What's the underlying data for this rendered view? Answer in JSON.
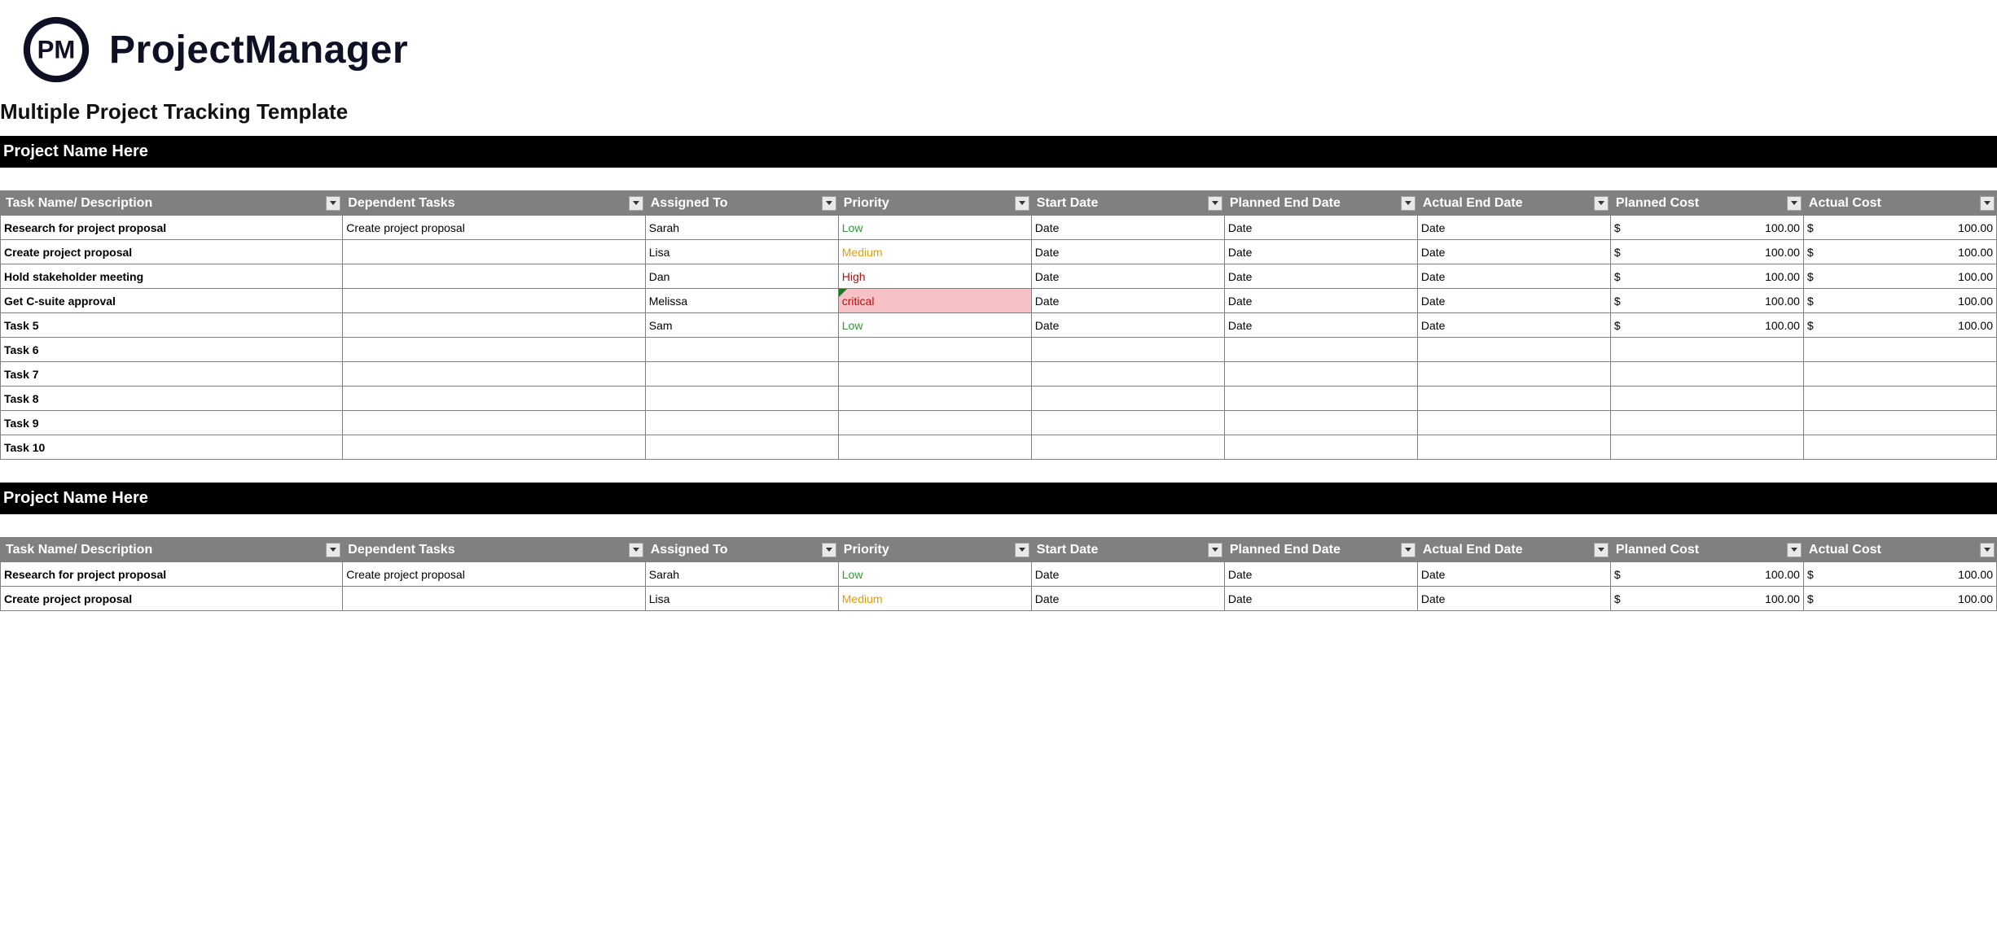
{
  "brand": {
    "logo_text": "PM",
    "title": "ProjectManager"
  },
  "template_title": "Multiple Project Tracking Template",
  "columns": {
    "task": "Task Name/ Description",
    "dependent": "Dependent Tasks",
    "assigned": "Assigned To",
    "priority": "Priority",
    "start": "Start Date",
    "planned_end": "Planned End Date",
    "actual_end": "Actual End Date",
    "planned_cost": "Planned Cost",
    "actual_cost": "Actual Cost"
  },
  "currency_symbol": "$",
  "projects": [
    {
      "name": "Project Name Here",
      "rows": [
        {
          "task": "Research for project proposal",
          "dependent": "Create project proposal",
          "assigned": "Sarah",
          "priority": "Low",
          "start": "Date",
          "planned_end": "Date",
          "actual_end": "Date",
          "planned_cost": "100.00",
          "actual_cost": "100.00"
        },
        {
          "task": "Create project proposal",
          "dependent": "",
          "assigned": "Lisa",
          "priority": "Medium",
          "start": "Date",
          "planned_end": "Date",
          "actual_end": "Date",
          "planned_cost": "100.00",
          "actual_cost": "100.00"
        },
        {
          "task": "Hold stakeholder meeting",
          "dependent": "",
          "assigned": "Dan",
          "priority": "High",
          "start": "Date",
          "planned_end": "Date",
          "actual_end": "Date",
          "planned_cost": "100.00",
          "actual_cost": "100.00"
        },
        {
          "task": "Get C-suite approval",
          "dependent": "",
          "assigned": "Melissa",
          "priority": "critical",
          "start": "Date",
          "planned_end": "Date",
          "actual_end": "Date",
          "planned_cost": "100.00",
          "actual_cost": "100.00"
        },
        {
          "task": "Task 5",
          "dependent": "",
          "assigned": "Sam",
          "priority": "Low",
          "start": "Date",
          "planned_end": "Date",
          "actual_end": "Date",
          "planned_cost": "100.00",
          "actual_cost": "100.00"
        },
        {
          "task": "Task 6",
          "dependent": "",
          "assigned": "",
          "priority": "",
          "start": "",
          "planned_end": "",
          "actual_end": "",
          "planned_cost": "",
          "actual_cost": ""
        },
        {
          "task": "Task 7",
          "dependent": "",
          "assigned": "",
          "priority": "",
          "start": "",
          "planned_end": "",
          "actual_end": "",
          "planned_cost": "",
          "actual_cost": ""
        },
        {
          "task": "Task 8",
          "dependent": "",
          "assigned": "",
          "priority": "",
          "start": "",
          "planned_end": "",
          "actual_end": "",
          "planned_cost": "",
          "actual_cost": ""
        },
        {
          "task": "Task 9",
          "dependent": "",
          "assigned": "",
          "priority": "",
          "start": "",
          "planned_end": "",
          "actual_end": "",
          "planned_cost": "",
          "actual_cost": ""
        },
        {
          "task": "Task 10",
          "dependent": "",
          "assigned": "",
          "priority": "",
          "start": "",
          "planned_end": "",
          "actual_end": "",
          "planned_cost": "",
          "actual_cost": ""
        }
      ]
    },
    {
      "name": "Project Name Here",
      "rows": [
        {
          "task": "Research for project proposal",
          "dependent": "Create project proposal",
          "assigned": "Sarah",
          "priority": "Low",
          "start": "Date",
          "planned_end": "Date",
          "actual_end": "Date",
          "planned_cost": "100.00",
          "actual_cost": "100.00"
        },
        {
          "task": "Create project proposal",
          "dependent": "",
          "assigned": "Lisa",
          "priority": "Medium",
          "start": "Date",
          "planned_end": "Date",
          "actual_end": "Date",
          "planned_cost": "100.00",
          "actual_cost": "100.00"
        }
      ]
    }
  ]
}
